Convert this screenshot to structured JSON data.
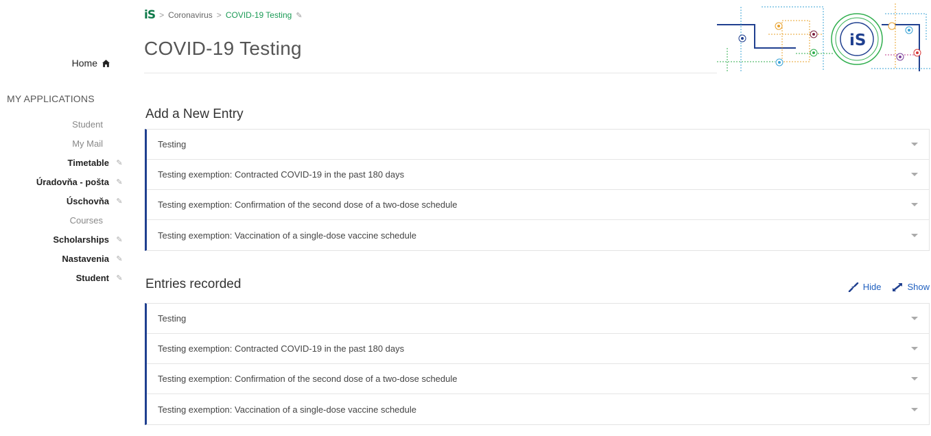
{
  "breadcrumb": {
    "logo": "iS",
    "items": [
      "Coronavirus",
      "COVID-19 Testing"
    ],
    "separator": ">"
  },
  "page_title": "COVID-19 Testing",
  "sidebar": {
    "home_label": "Home",
    "section_title": "MY APPLICATIONS",
    "items": [
      {
        "label": "Student",
        "bold": false,
        "pinned": false
      },
      {
        "label": "My Mail",
        "bold": false,
        "pinned": false
      },
      {
        "label": "Timetable",
        "bold": true,
        "pinned": true
      },
      {
        "label": "Úradovňa - pošta",
        "bold": true,
        "pinned": true
      },
      {
        "label": "Úschovňa",
        "bold": true,
        "pinned": true
      },
      {
        "label": "Courses",
        "bold": false,
        "pinned": false
      },
      {
        "label": "Scholarships",
        "bold": true,
        "pinned": true
      },
      {
        "label": "Nastavenia",
        "bold": true,
        "pinned": true
      },
      {
        "label": "Student",
        "bold": true,
        "pinned": true
      }
    ]
  },
  "add_section": {
    "title": "Add a New Entry",
    "rows": [
      "Testing",
      "Testing exemption: Contracted COVID-19 in the past 180 days",
      "Testing exemption: Confirmation of the second dose of a two-dose schedule",
      "Testing exemption: Vaccination of a single-dose vaccine schedule"
    ]
  },
  "recorded_section": {
    "title": "Entries recorded",
    "hide_label": "Hide",
    "show_label": "Show",
    "rows": [
      "Testing",
      "Testing exemption: Contracted COVID-19 in the past 180 days",
      "Testing exemption: Confirmation of the second dose of a two-dose schedule",
      "Testing exemption: Vaccination of a single-dose vaccine schedule"
    ]
  },
  "colors": {
    "accent_blue": "#1f3f8f",
    "link_blue": "#1f5fbf",
    "green": "#1a9a55"
  }
}
